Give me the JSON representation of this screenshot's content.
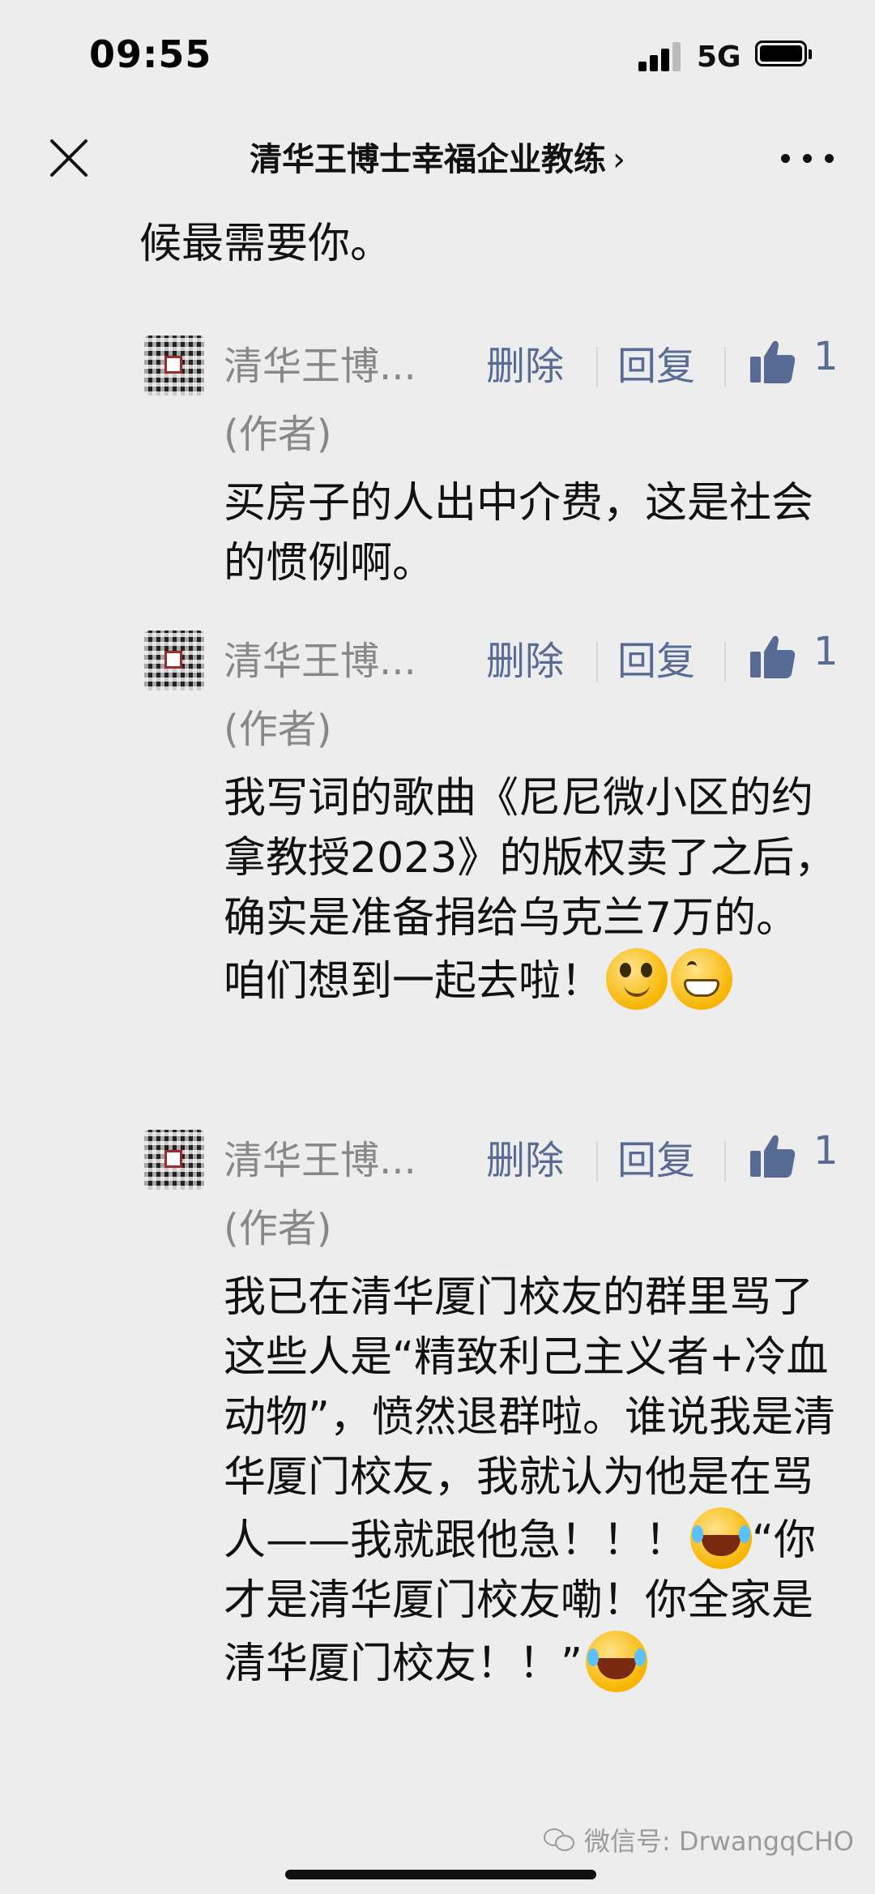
{
  "status_bar": {
    "time": "09:55",
    "network": "5G"
  },
  "nav": {
    "title": "清华王博士幸福企业教练",
    "chevron": "›"
  },
  "lead_text": "行吗。然后搬到乌克兰住，人家这时候最需要你。",
  "replies": [
    {
      "name": "清华王博...",
      "delete_label": "删除",
      "reply_label": "回复",
      "likes": "1",
      "role": "(作者)",
      "text": "买房子的人出中介费，这是社会的惯例啊。"
    },
    {
      "name": "清华王博...",
      "delete_label": "删除",
      "reply_label": "回复",
      "likes": "1",
      "role": "(作者)",
      "text": "我写词的歌曲《尼尼微小区的约拿教授2023》的版权卖了之后，确实是准备捐给乌克兰7万的。咱们想到一起去啦！"
    },
    {
      "name": "清华王博...",
      "delete_label": "删除",
      "reply_label": "回复",
      "likes": "1",
      "role": "(作者)",
      "text": "我已在清华厦门校友的群里骂了这些人是“精致利己主义者+冷血动物”，愤然退群啦。谁说我是清华厦门校友，我就认为他是在骂人——我就跟他急！！！",
      "text_after_emoji": "“你才是清华厦门校友嘞！你全家是清华厦门校友！！”"
    }
  ],
  "watermark": "微信号: DrwangqCHO",
  "colors": {
    "link": "#576b95",
    "meta": "#888888",
    "background": "#ededed"
  }
}
